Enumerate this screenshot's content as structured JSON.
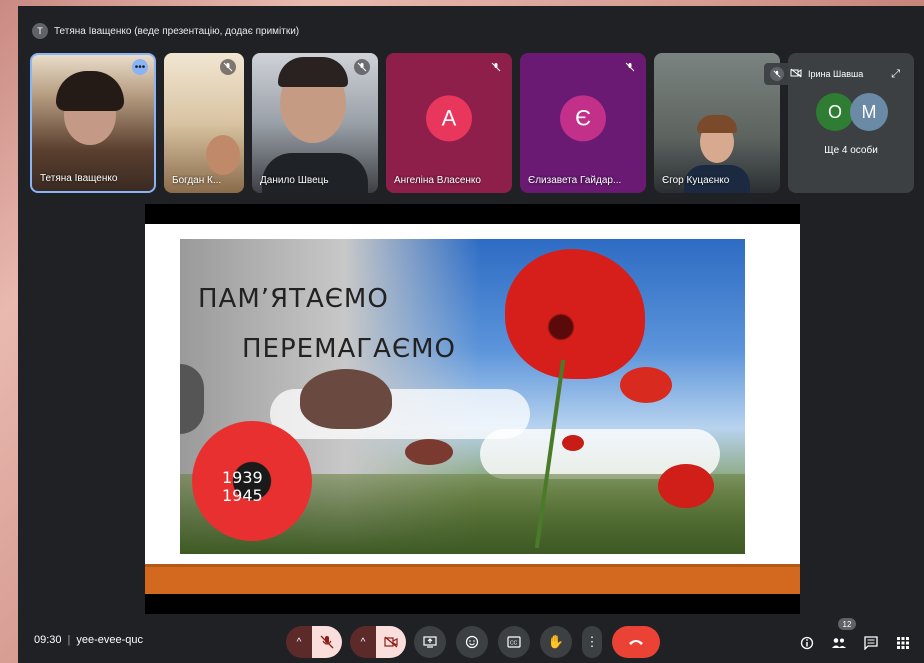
{
  "presenter": {
    "initial": "T",
    "text": "Тетяна Іващенко (веде презентацію, додає примітки)"
  },
  "participants": [
    {
      "name": "Тетяна Іващенко",
      "kind": "video",
      "bg": "#6b5a4a"
    },
    {
      "name": "Богдан К...",
      "kind": "video",
      "bg": "#d9c7a8"
    },
    {
      "name": "Данило Швець",
      "kind": "video",
      "bg": "#b4b8bf"
    },
    {
      "name": "Ангеліна Власенко",
      "kind": "avatar",
      "initial": "А",
      "bg": "#8e1f4a",
      "avatar_color": "#e8365d"
    },
    {
      "name": "Єлизавета Гайдар...",
      "kind": "avatar",
      "initial": "Є",
      "bg": "#6a1a73",
      "avatar_color": "#c2308a"
    },
    {
      "name": "Єгор Куцаєнко",
      "kind": "video",
      "bg": "#5d6460"
    }
  ],
  "more_tile": {
    "pinned_name": "Ірина Шавша",
    "avatars": [
      {
        "initial": "О",
        "color": "#2e7d32"
      },
      {
        "initial": "М",
        "color": "#6b8aa6"
      }
    ],
    "label": "Ще 4 особи"
  },
  "slide": {
    "line1": "ПАМ’ЯТАЄМО",
    "line2": "ПЕРЕМАГАЄМО",
    "year1": "1939",
    "year2": "1945"
  },
  "bottom_bar": {
    "time": "09:30",
    "meeting_code": "yee-evee-quc",
    "people_count": "12"
  },
  "icons": [
    "mic-off-icon",
    "camera-off-icon",
    "present-icon",
    "emoji-icon",
    "captions-icon",
    "raise-hand-icon",
    "more-icon",
    "end-call-icon",
    "info-icon",
    "people-icon",
    "chat-icon",
    "activities-icon"
  ],
  "colors": {
    "background": "#202124",
    "end_call": "#ea4335",
    "slide_accent": "#d2691e"
  }
}
